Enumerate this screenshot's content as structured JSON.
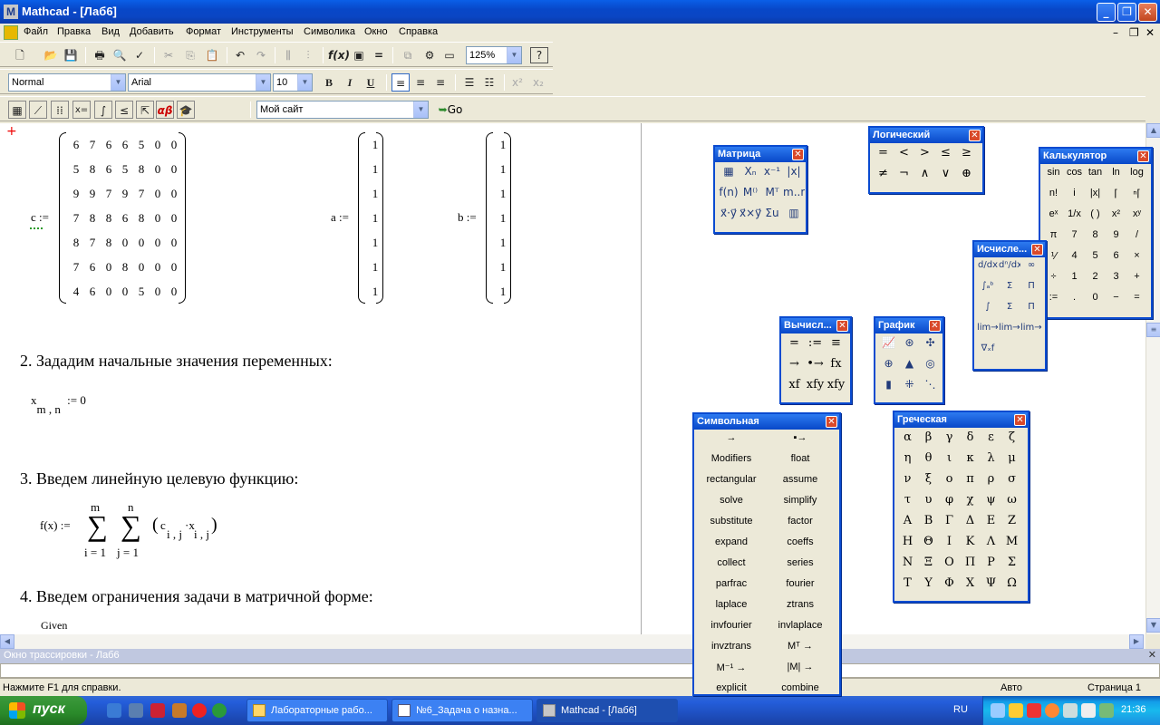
{
  "window": {
    "title": "Mathcad - [Лаб6]"
  },
  "menu": [
    "Файл",
    "Правка",
    "Вид",
    "Добавить",
    "Формат",
    "Инструменты",
    "Символика",
    "Окно",
    "Справка"
  ],
  "toolbar": {
    "zoom": "125%",
    "style": "Normal",
    "font": "Arial",
    "size": "10",
    "site": "Мой сайт",
    "go": "Go"
  },
  "worksheet": {
    "var_c": "c :=",
    "var_a": "a :=",
    "var_b": "b :=",
    "matrix_c": [
      [
        "6",
        "7",
        "6",
        "6",
        "5",
        "0",
        "0"
      ],
      [
        "5",
        "8",
        "6",
        "5",
        "8",
        "0",
        "0"
      ],
      [
        "9",
        "9",
        "7",
        "9",
        "7",
        "0",
        "0"
      ],
      [
        "7",
        "8",
        "8",
        "6",
        "8",
        "0",
        "0"
      ],
      [
        "8",
        "7",
        "8",
        "0",
        "0",
        "0",
        "0"
      ],
      [
        "7",
        "6",
        "0",
        "8",
        "0",
        "0",
        "0"
      ],
      [
        "4",
        "6",
        "0",
        "0",
        "5",
        "0",
        "0"
      ]
    ],
    "vector_a": [
      "1",
      "1",
      "1",
      "1",
      "1",
      "1",
      "1"
    ],
    "vector_b": [
      "1",
      "1",
      "1",
      "1",
      "1",
      "1",
      "1"
    ],
    "step2": "2. Зададим начальные значения переменных:",
    "init_x": "x",
    "init_sub": "m , n",
    "init_val": ":= 0",
    "step3": "3. Введем линейную целевую функцию:",
    "fx": "f(x) :=",
    "sum_upper1": "m",
    "sum_upper2": "n",
    "sum_lower1": "i = 1",
    "sum_lower2": "j = 1",
    "sum_body_c": "c",
    "sum_body_csub": "i , j",
    "sum_body_x": "·x",
    "sum_body_xsub": "i , j",
    "step4": "4. Введем ограничения задачи в матричной форме:",
    "given": "Given"
  },
  "palettes": {
    "matrix": {
      "title": "Матрица",
      "items": [
        "▦",
        "Xₙ",
        "x⁻¹",
        "|x|",
        "f(n)",
        "M⁽⁾",
        "Mᵀ",
        "m..n",
        "x⃗·y⃗",
        "x⃗×y⃗",
        "Σu",
        "▥"
      ]
    },
    "logic": {
      "title": "Логический",
      "items": [
        "=",
        "<",
        ">",
        "≤",
        "≥",
        "≠",
        "¬",
        "∧",
        "∨",
        "⊕"
      ]
    },
    "calculator": {
      "title": "Калькулятор",
      "items": [
        "sin",
        "cos",
        "tan",
        "ln",
        "log",
        "n!",
        "i",
        "|x|",
        "⌈",
        "ⁿ⌈",
        "eˣ",
        "1/x",
        "( )",
        "x²",
        "xʸ",
        "π",
        "7",
        "8",
        "9",
        "/",
        "⅟",
        "4",
        "5",
        "6",
        "×",
        "÷",
        "1",
        "2",
        "3",
        "+",
        ":=",
        ".",
        "0",
        "−",
        "="
      ]
    },
    "calculus": {
      "title": "Исчисле...",
      "items": [
        "d/dx",
        "dⁿ/dxⁿ",
        "∞",
        "∫ₐᵇ",
        "Σ",
        "Π",
        "∫",
        "Σ",
        "Π",
        "lim→a",
        "lim→a⁺",
        "lim→a⁻",
        "∇ₓf"
      ]
    },
    "evaluation": {
      "title": "Вычисл...",
      "items": [
        "=",
        ":=",
        "≡",
        "→",
        "•→",
        "fx",
        "xf",
        "xfy",
        "xfy"
      ]
    },
    "graph": {
      "title": "График",
      "items": [
        "📈",
        "⊛",
        "✣",
        "⊕",
        "▲",
        "◎",
        "▮",
        "⁜",
        "⋱"
      ]
    },
    "symbolic": {
      "title": "Символьная",
      "items": [
        "→",
        "▪→",
        "Modifiers",
        "float",
        "rectangular",
        "assume",
        "solve",
        "simplify",
        "substitute",
        "factor",
        "expand",
        "coeffs",
        "collect",
        "series",
        "parfrac",
        "fourier",
        "laplace",
        "ztrans",
        "invfourier",
        "invlaplace",
        "invztrans",
        "Mᵀ →",
        "M⁻¹ →",
        "|M| →",
        "explicit",
        "combine"
      ]
    },
    "greek": {
      "title": "Греческая",
      "items": [
        "α",
        "β",
        "γ",
        "δ",
        "ε",
        "ζ",
        "η",
        "θ",
        "ι",
        "κ",
        "λ",
        "μ",
        "ν",
        "ξ",
        "ο",
        "π",
        "ρ",
        "σ",
        "τ",
        "υ",
        "φ",
        "χ",
        "ψ",
        "ω",
        "Α",
        "Β",
        "Γ",
        "Δ",
        "Ε",
        "Ζ",
        "Η",
        "Θ",
        "Ι",
        "Κ",
        "Λ",
        "Μ",
        "Ν",
        "Ξ",
        "Ο",
        "Π",
        "Ρ",
        "Σ",
        "Τ",
        "Υ",
        "Φ",
        "Χ",
        "Ψ",
        "Ω"
      ]
    }
  },
  "trace": {
    "title": "Окно трассировки - Лаб6"
  },
  "status": {
    "help": "Нажмите F1 для справки.",
    "mode": "Авто",
    "page": "Страница 1"
  },
  "taskbar": {
    "start": "пуск",
    "tasks": [
      "Лабораторные рабо...",
      "№6_Задача о назна...",
      "Mathcad - [Лаб6]"
    ],
    "lang": "RU",
    "clock": "21:36"
  }
}
